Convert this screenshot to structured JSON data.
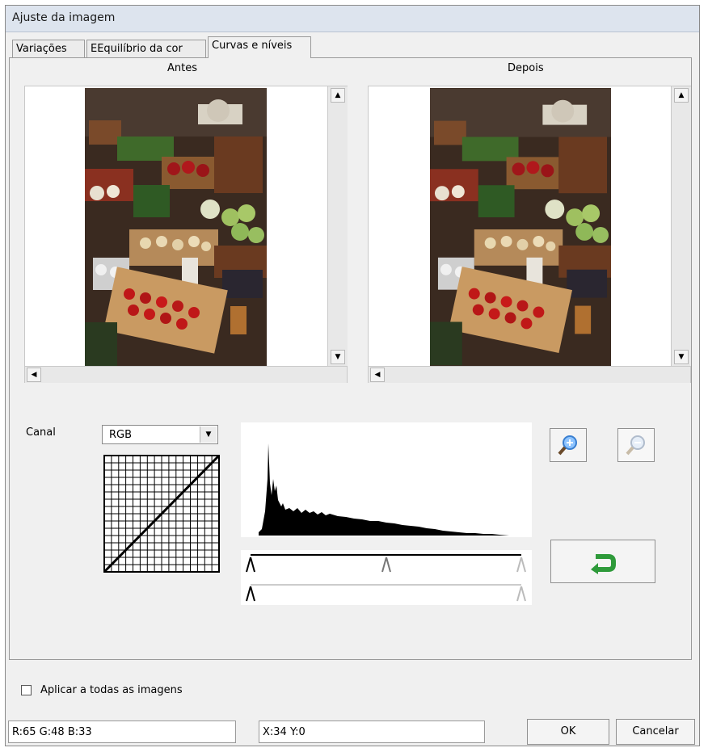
{
  "window": {
    "title": "Ajuste da imagem"
  },
  "tabs": [
    {
      "label": "Variações",
      "active": false
    },
    {
      "label": "EEquilíbrio da cor",
      "active": false
    },
    {
      "label": "Curvas e níveis",
      "active": true
    }
  ],
  "preview": {
    "before_label": "Antes",
    "after_label": "Depois"
  },
  "channel": {
    "label": "Canal",
    "value": "RGB"
  },
  "toolbar": {
    "zoom_in": "zoom-in-icon",
    "zoom_out": "zoom-out-icon",
    "reset": "undo-arrow-icon"
  },
  "footer": {
    "apply_all_label": "Aplicar a todas as imagens",
    "apply_all_checked": false,
    "rgb_readout": "R:65 G:48 B:33",
    "xy_readout": "X:34 Y:0",
    "ok_label": "OK",
    "cancel_label": "Cancelar"
  },
  "colors": {
    "titlebar": "#dde4ee",
    "window": "#f0f0f0",
    "reset_arrow": "#2e9a3a",
    "zoom_in_lens": "#3a7fd0"
  }
}
